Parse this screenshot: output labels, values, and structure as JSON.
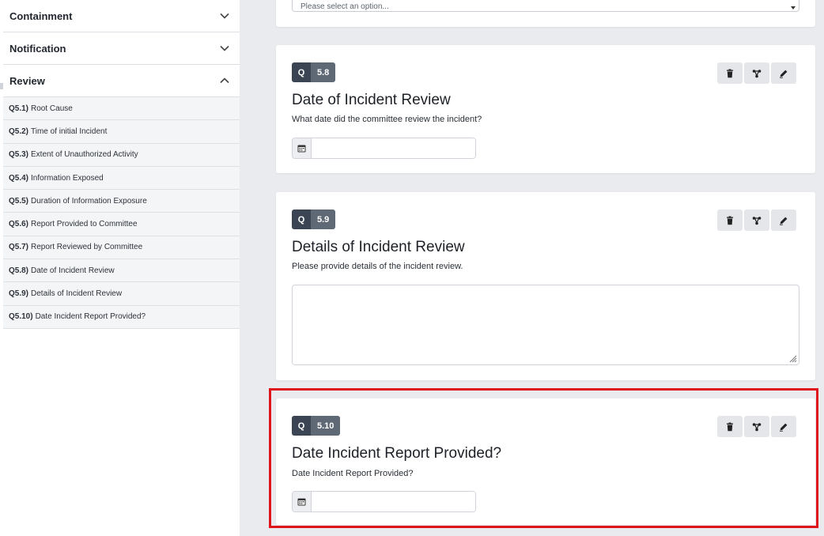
{
  "sidebar": {
    "sections": [
      {
        "label": "Containment",
        "state": "collapsed"
      },
      {
        "label": "Notification",
        "state": "collapsed"
      },
      {
        "label": "Review",
        "state": "expanded"
      }
    ],
    "review_items": [
      {
        "num": "Q5.1)",
        "label": "Root Cause"
      },
      {
        "num": "Q5.2)",
        "label": "Time of initial Incident"
      },
      {
        "num": "Q5.3)",
        "label": "Extent of Unauthorized Activity"
      },
      {
        "num": "Q5.4)",
        "label": "Information Exposed"
      },
      {
        "num": "Q5.5)",
        "label": "Duration of Information Exposure"
      },
      {
        "num": "Q5.6)",
        "label": "Report Provided to Committee"
      },
      {
        "num": "Q5.7)",
        "label": "Report Reviewed by Committee"
      },
      {
        "num": "Q5.8)",
        "label": "Date of Incident Review"
      },
      {
        "num": "Q5.9)",
        "label": "Details of Incident Review"
      },
      {
        "num": "Q5.10)",
        "label": "Date Incident Report Provided?"
      }
    ]
  },
  "top_select": {
    "placeholder": "Please select an option..."
  },
  "questions": [
    {
      "q": "Q",
      "number": "5.8",
      "title": "Date of Incident Review",
      "description": "What date did the committee review the incident?",
      "input_type": "date",
      "value": ""
    },
    {
      "q": "Q",
      "number": "5.9",
      "title": "Details of Incident Review",
      "description": "Please provide details of the incident review.",
      "input_type": "textarea",
      "value": ""
    },
    {
      "q": "Q",
      "number": "5.10",
      "title": "Date Incident Report Provided?",
      "description": "Date Incident Report Provided?",
      "input_type": "date",
      "value": ""
    }
  ],
  "icons": {
    "delete": "trash-icon",
    "branch": "branch-icon",
    "edit": "pencil-icon",
    "calendar": "calendar-icon",
    "chevron_down": "chevron-down-icon",
    "chevron_up": "chevron-up-icon"
  },
  "colors": {
    "highlight": "#e0141c",
    "badge_dark": "#3a4452",
    "badge_light": "#5f6875",
    "background": "#e9ebef"
  }
}
